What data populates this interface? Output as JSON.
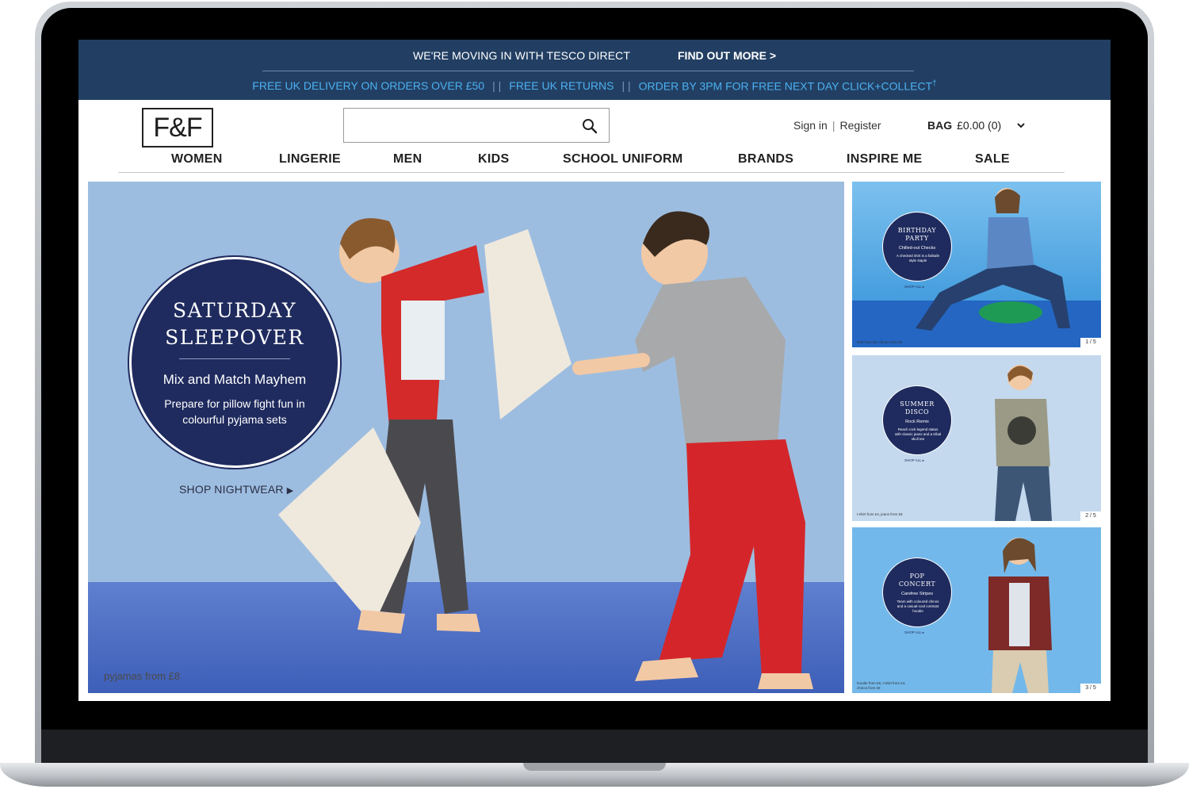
{
  "promo": {
    "moving_text": "WE'RE MOVING IN WITH TESCO DIRECT",
    "find_out_more": "FIND OUT MORE >",
    "delivery": "FREE UK DELIVERY ON ORDERS OVER £50",
    "returns": "FREE UK RETURNS",
    "click_collect": "ORDER BY 3PM FOR FREE NEXT DAY CLICK+COLLECT",
    "click_collect_mark": "†",
    "pipes": "| |"
  },
  "header": {
    "logo": "F&F",
    "search_placeholder": "",
    "sign_in": "Sign in",
    "account_pipe": "|",
    "register": "Register",
    "bag_label": "BAG",
    "bag_total": "£0.00 (0)"
  },
  "nav": [
    "WOMEN",
    "LINGERIE",
    "MEN",
    "KIDS",
    "SCHOOL UNIFORM",
    "BRANDS",
    "INSPIRE ME",
    "SALE"
  ],
  "hero": {
    "title_line1": "SATURDAY",
    "title_line2": "SLEEPOVER",
    "subtitle": "Mix and Match Mayhem",
    "description": "Prepare for pillow fight fun in colourful pyjama sets",
    "cta": "SHOP NIGHTWEAR",
    "cta_arrow": "▶",
    "caption": "pyjamas from £8"
  },
  "tiles": [
    {
      "title_line1": "BIRTHDAY",
      "title_line2": "PARTY",
      "subtitle": "Chilled-out Checks",
      "description": "A checked shirt is a failsafe style staple",
      "shop": "SHOP ALL ▸",
      "caption": "shirt from £8, chinos from £8",
      "page": "1 / 5"
    },
    {
      "title_line1": "SUMMER",
      "title_line2": "DISCO",
      "subtitle": "Rock Remix",
      "description": "Reach rock legend status with classic jeans and a tribal skull tee",
      "shop": "SHOP ALL ▸",
      "caption": "t-shirt from £4, jeans from £8",
      "page": "2 / 5"
    },
    {
      "title_line1": "POP",
      "title_line2": "CONCERT",
      "subtitle": "Carefree Stripes",
      "description": "Team with coloured chinos and a casual-cool contrast hoodie",
      "shop": "SHOP ALL ▸",
      "caption": "hoodie from £8, t-shirt from £4, chinos from £8",
      "page": "3 / 5"
    }
  ],
  "colors": {
    "promo_bg": "#223f63",
    "promo_link": "#4cb0f0",
    "badge_navy": "#1f2b5e",
    "hero_wall": "#9dbde0"
  },
  "icons": {
    "search": "search-icon",
    "bag_dropdown": "chevron-down-icon"
  }
}
